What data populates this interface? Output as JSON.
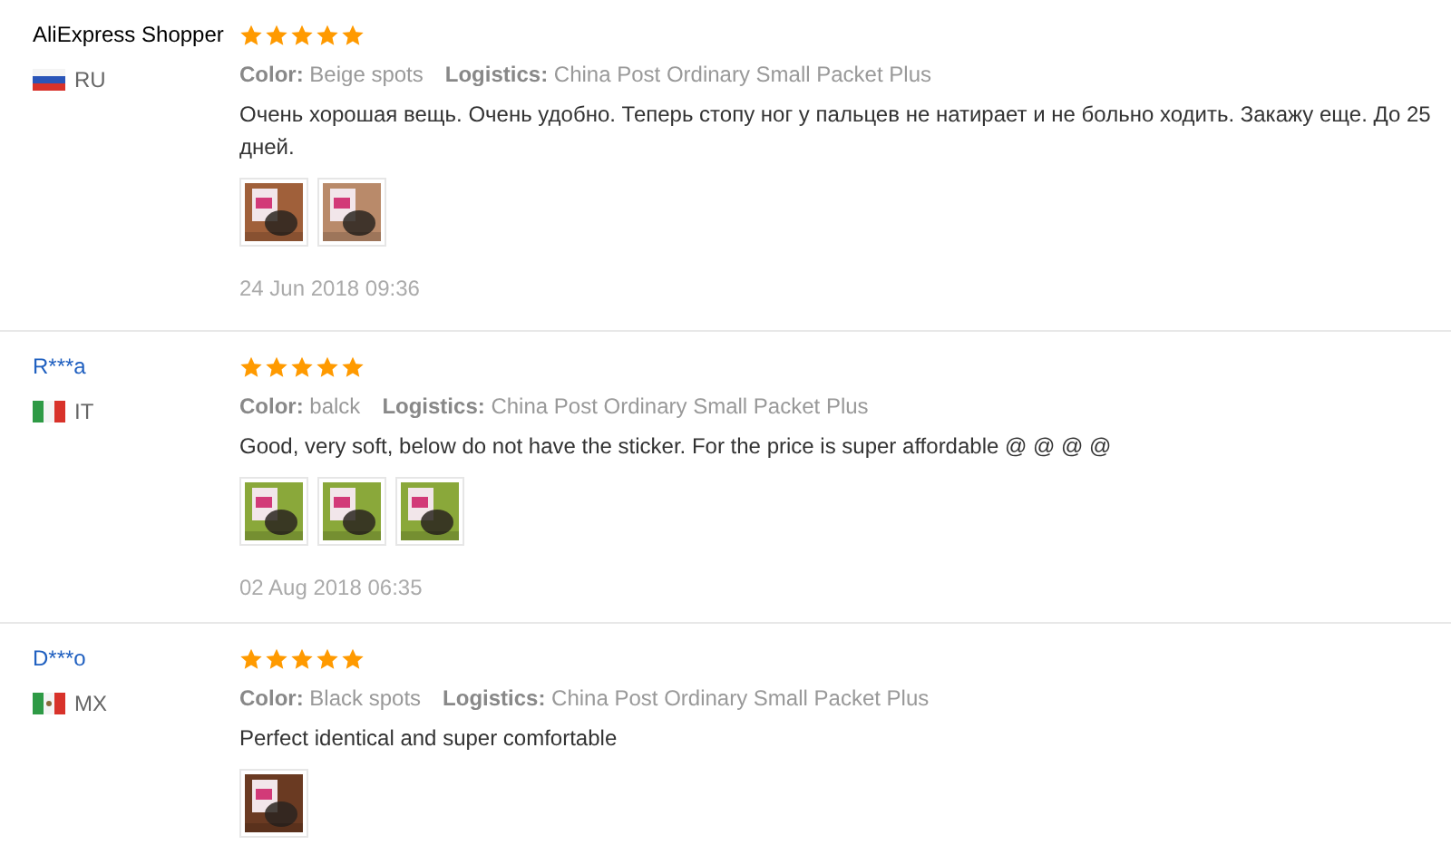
{
  "reviews": [
    {
      "name": "AliExpress Shopper",
      "linked": false,
      "flag": {
        "kind": "russia"
      },
      "country": "RU",
      "stars": 5,
      "color_label": "Color:",
      "color_value": "Beige spots",
      "logistics_label": "Logistics:",
      "logistics_value": "China Post Ordinary Small Packet Plus",
      "text": "Очень хорошая вещь. Очень удобно. Теперь стопу ног у пальцев не натирает и не больно ходить. Закажу еще. До 25 дней.",
      "photos": [
        {
          "kind": "picture"
        },
        {
          "kind": "picture"
        }
      ],
      "date": "24 Jun 2018 09:36"
    },
    {
      "name": "R***a",
      "linked": true,
      "flag": {
        "kind": "italy"
      },
      "country": "IT",
      "stars": 5,
      "color_label": "Color:",
      "color_value": "balck",
      "logistics_label": "Logistics:",
      "logistics_value": "China Post Ordinary Small Packet Plus",
      "text": "Good, very soft, below do not have the sticker. For the price is super affordable @ @ @ @",
      "photos": [
        {
          "kind": "picture"
        },
        {
          "kind": "picture"
        },
        {
          "kind": "picture"
        }
      ],
      "date": "02 Aug 2018 06:35"
    },
    {
      "name": "D***o",
      "linked": true,
      "flag": {
        "kind": "mexico"
      },
      "country": "MX",
      "stars": 5,
      "color_label": "Color:",
      "color_value": "Black spots",
      "logistics_label": "Logistics:",
      "logistics_value": "China Post Ordinary Small Packet Plus",
      "text": "Perfect identical and super comfortable",
      "photos": [
        {
          "kind": "picture"
        }
      ]
    }
  ]
}
